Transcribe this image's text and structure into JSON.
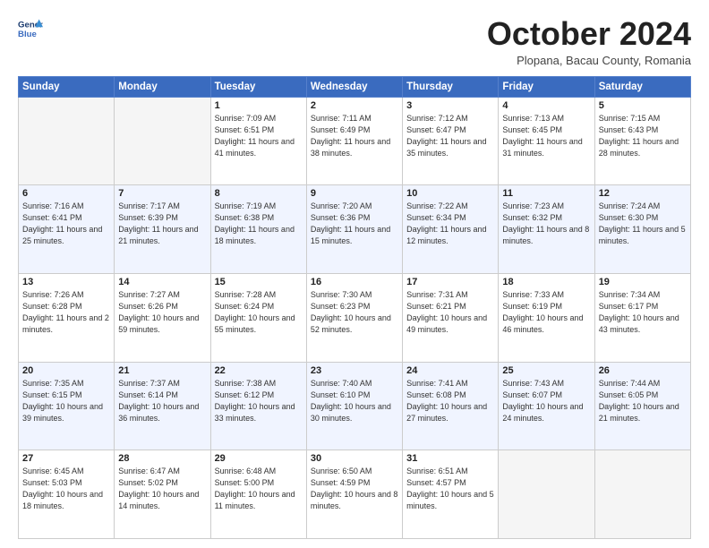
{
  "logo": {
    "line1": "General",
    "line2": "Blue"
  },
  "title": "October 2024",
  "location": "Plopana, Bacau County, Romania",
  "weekdays": [
    "Sunday",
    "Monday",
    "Tuesday",
    "Wednesday",
    "Thursday",
    "Friday",
    "Saturday"
  ],
  "weeks": [
    [
      {
        "day": "",
        "info": ""
      },
      {
        "day": "",
        "info": ""
      },
      {
        "day": "1",
        "info": "Sunrise: 7:09 AM\nSunset: 6:51 PM\nDaylight: 11 hours and 41 minutes."
      },
      {
        "day": "2",
        "info": "Sunrise: 7:11 AM\nSunset: 6:49 PM\nDaylight: 11 hours and 38 minutes."
      },
      {
        "day": "3",
        "info": "Sunrise: 7:12 AM\nSunset: 6:47 PM\nDaylight: 11 hours and 35 minutes."
      },
      {
        "day": "4",
        "info": "Sunrise: 7:13 AM\nSunset: 6:45 PM\nDaylight: 11 hours and 31 minutes."
      },
      {
        "day": "5",
        "info": "Sunrise: 7:15 AM\nSunset: 6:43 PM\nDaylight: 11 hours and 28 minutes."
      }
    ],
    [
      {
        "day": "6",
        "info": "Sunrise: 7:16 AM\nSunset: 6:41 PM\nDaylight: 11 hours and 25 minutes."
      },
      {
        "day": "7",
        "info": "Sunrise: 7:17 AM\nSunset: 6:39 PM\nDaylight: 11 hours and 21 minutes."
      },
      {
        "day": "8",
        "info": "Sunrise: 7:19 AM\nSunset: 6:38 PM\nDaylight: 11 hours and 18 minutes."
      },
      {
        "day": "9",
        "info": "Sunrise: 7:20 AM\nSunset: 6:36 PM\nDaylight: 11 hours and 15 minutes."
      },
      {
        "day": "10",
        "info": "Sunrise: 7:22 AM\nSunset: 6:34 PM\nDaylight: 11 hours and 12 minutes."
      },
      {
        "day": "11",
        "info": "Sunrise: 7:23 AM\nSunset: 6:32 PM\nDaylight: 11 hours and 8 minutes."
      },
      {
        "day": "12",
        "info": "Sunrise: 7:24 AM\nSunset: 6:30 PM\nDaylight: 11 hours and 5 minutes."
      }
    ],
    [
      {
        "day": "13",
        "info": "Sunrise: 7:26 AM\nSunset: 6:28 PM\nDaylight: 11 hours and 2 minutes."
      },
      {
        "day": "14",
        "info": "Sunrise: 7:27 AM\nSunset: 6:26 PM\nDaylight: 10 hours and 59 minutes."
      },
      {
        "day": "15",
        "info": "Sunrise: 7:28 AM\nSunset: 6:24 PM\nDaylight: 10 hours and 55 minutes."
      },
      {
        "day": "16",
        "info": "Sunrise: 7:30 AM\nSunset: 6:23 PM\nDaylight: 10 hours and 52 minutes."
      },
      {
        "day": "17",
        "info": "Sunrise: 7:31 AM\nSunset: 6:21 PM\nDaylight: 10 hours and 49 minutes."
      },
      {
        "day": "18",
        "info": "Sunrise: 7:33 AM\nSunset: 6:19 PM\nDaylight: 10 hours and 46 minutes."
      },
      {
        "day": "19",
        "info": "Sunrise: 7:34 AM\nSunset: 6:17 PM\nDaylight: 10 hours and 43 minutes."
      }
    ],
    [
      {
        "day": "20",
        "info": "Sunrise: 7:35 AM\nSunset: 6:15 PM\nDaylight: 10 hours and 39 minutes."
      },
      {
        "day": "21",
        "info": "Sunrise: 7:37 AM\nSunset: 6:14 PM\nDaylight: 10 hours and 36 minutes."
      },
      {
        "day": "22",
        "info": "Sunrise: 7:38 AM\nSunset: 6:12 PM\nDaylight: 10 hours and 33 minutes."
      },
      {
        "day": "23",
        "info": "Sunrise: 7:40 AM\nSunset: 6:10 PM\nDaylight: 10 hours and 30 minutes."
      },
      {
        "day": "24",
        "info": "Sunrise: 7:41 AM\nSunset: 6:08 PM\nDaylight: 10 hours and 27 minutes."
      },
      {
        "day": "25",
        "info": "Sunrise: 7:43 AM\nSunset: 6:07 PM\nDaylight: 10 hours and 24 minutes."
      },
      {
        "day": "26",
        "info": "Sunrise: 7:44 AM\nSunset: 6:05 PM\nDaylight: 10 hours and 21 minutes."
      }
    ],
    [
      {
        "day": "27",
        "info": "Sunrise: 6:45 AM\nSunset: 5:03 PM\nDaylight: 10 hours and 18 minutes."
      },
      {
        "day": "28",
        "info": "Sunrise: 6:47 AM\nSunset: 5:02 PM\nDaylight: 10 hours and 14 minutes."
      },
      {
        "day": "29",
        "info": "Sunrise: 6:48 AM\nSunset: 5:00 PM\nDaylight: 10 hours and 11 minutes."
      },
      {
        "day": "30",
        "info": "Sunrise: 6:50 AM\nSunset: 4:59 PM\nDaylight: 10 hours and 8 minutes."
      },
      {
        "day": "31",
        "info": "Sunrise: 6:51 AM\nSunset: 4:57 PM\nDaylight: 10 hours and 5 minutes."
      },
      {
        "day": "",
        "info": ""
      },
      {
        "day": "",
        "info": ""
      }
    ]
  ]
}
